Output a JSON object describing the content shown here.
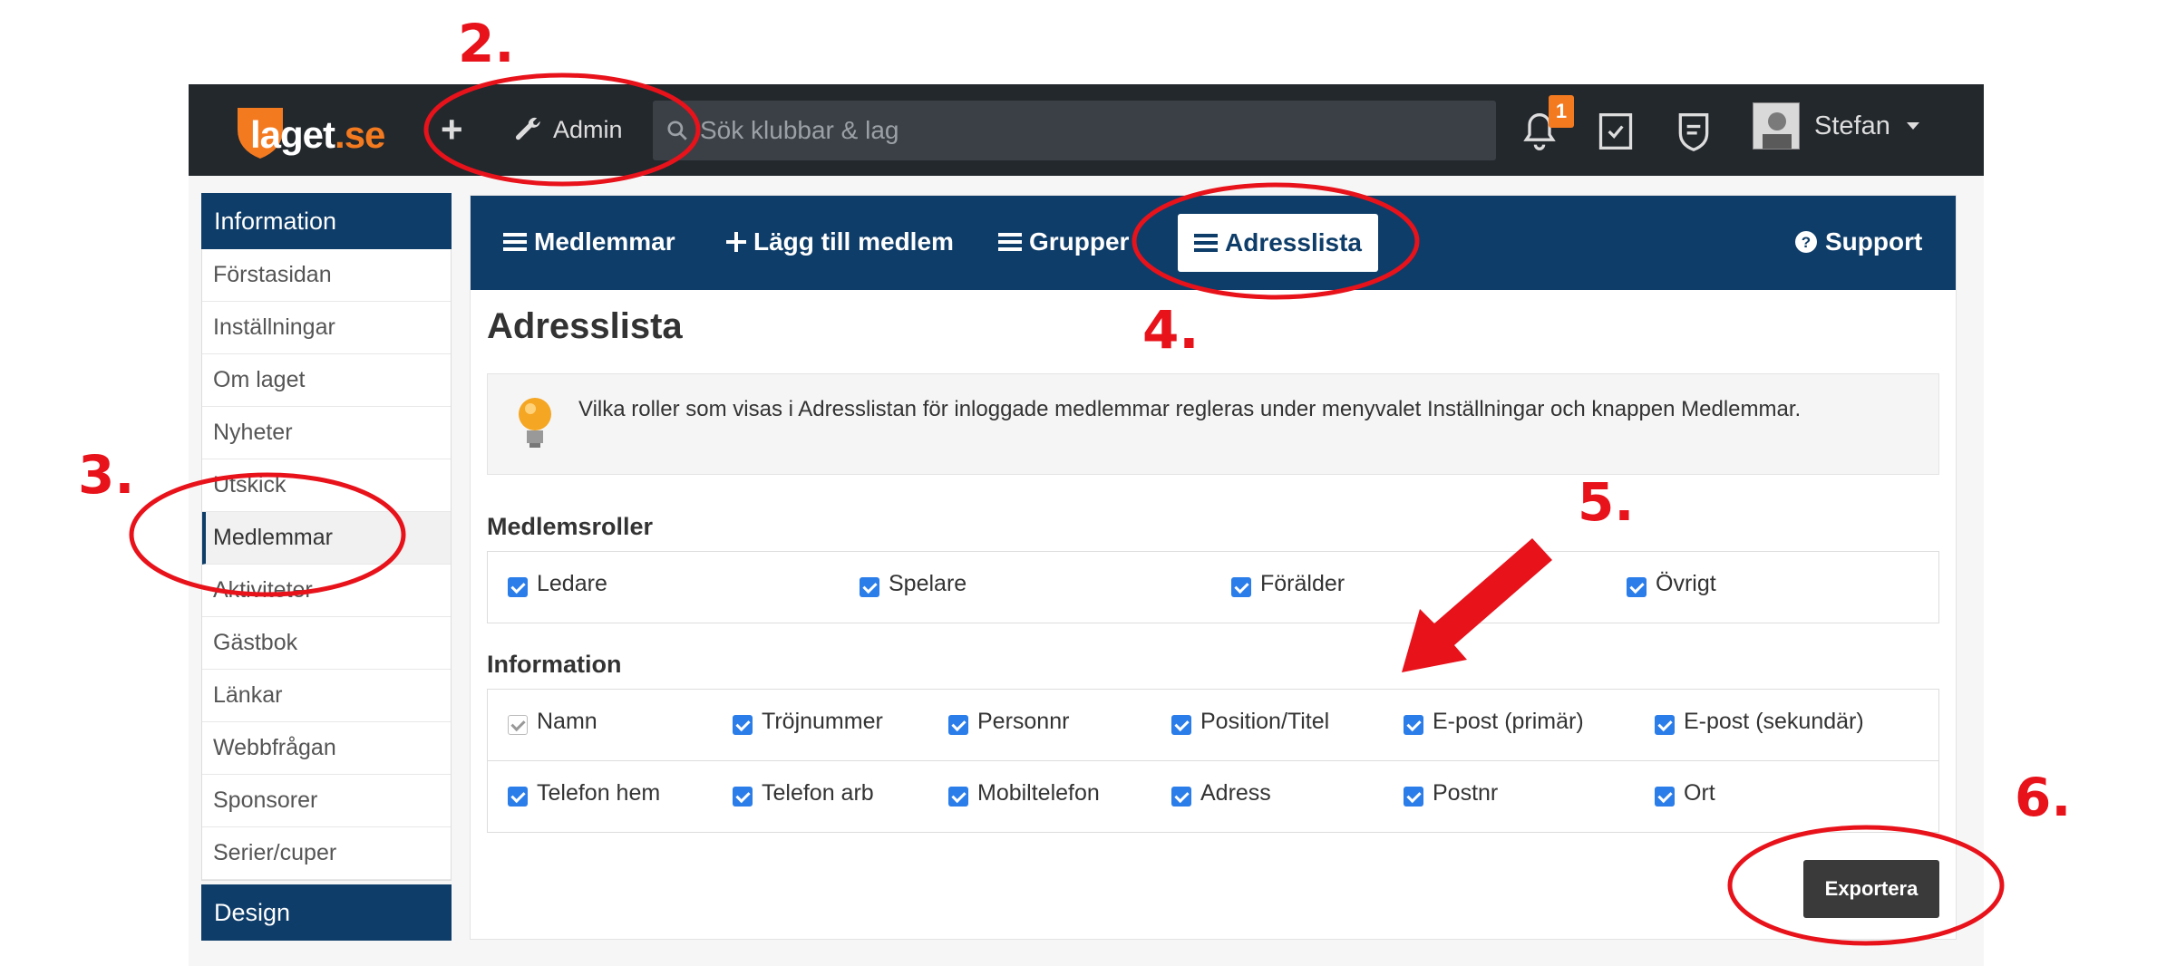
{
  "topbar": {
    "logo_text": "laget",
    "logo_suffix": ".se",
    "add_label": "+",
    "admin_label": "Admin",
    "search_placeholder": "Sök klubbar & lag",
    "notification_count": "1",
    "user_name": "Stefan"
  },
  "sidebar": {
    "header": "Information",
    "items": [
      {
        "label": "Förstasidan"
      },
      {
        "label": "Inställningar"
      },
      {
        "label": "Om laget"
      },
      {
        "label": "Nyheter"
      },
      {
        "label": "Utskick"
      },
      {
        "label": "Medlemmar"
      },
      {
        "label": "Aktiviteter"
      },
      {
        "label": "Gästbok"
      },
      {
        "label": "Länkar"
      },
      {
        "label": "Webbfrågan"
      },
      {
        "label": "Sponsorer"
      },
      {
        "label": "Serier/cuper"
      }
    ],
    "header2": "Design"
  },
  "nav": {
    "members": "Medlemmar",
    "add_member": "Lägg till medlem",
    "groups": "Grupper",
    "address_list": "Adresslista",
    "support": "Support"
  },
  "page": {
    "title": "Adresslista",
    "info": "Vilka roller som visas i Adresslistan för inloggade medlemmar regleras under menyvalet Inställningar och knappen Medlemmar.",
    "roles_title": "Medlemsroller",
    "roles": [
      "Ledare",
      "Spelare",
      "Förälder",
      "Övrigt"
    ],
    "info_title": "Information",
    "fields_row1": [
      "Namn",
      "Tröjnummer",
      "Personnr",
      "Position/Titel",
      "E-post (primär)",
      "E-post (sekundär)"
    ],
    "fields_row2": [
      "Telefon hem",
      "Telefon arb",
      "Mobiltelefon",
      "Adress",
      "Postnr",
      "Ort"
    ],
    "export_label": "Exportera"
  },
  "annotations": {
    "step2": "2.",
    "step3": "3.",
    "step4": "4.",
    "step5": "5.",
    "step6": "6."
  },
  "colors": {
    "brand_navy": "#0e3d69",
    "topbar_dark": "#23282d",
    "accent_orange": "#f47a20",
    "checkbox_blue": "#2b7de9",
    "annotation_red": "#e8121b"
  }
}
